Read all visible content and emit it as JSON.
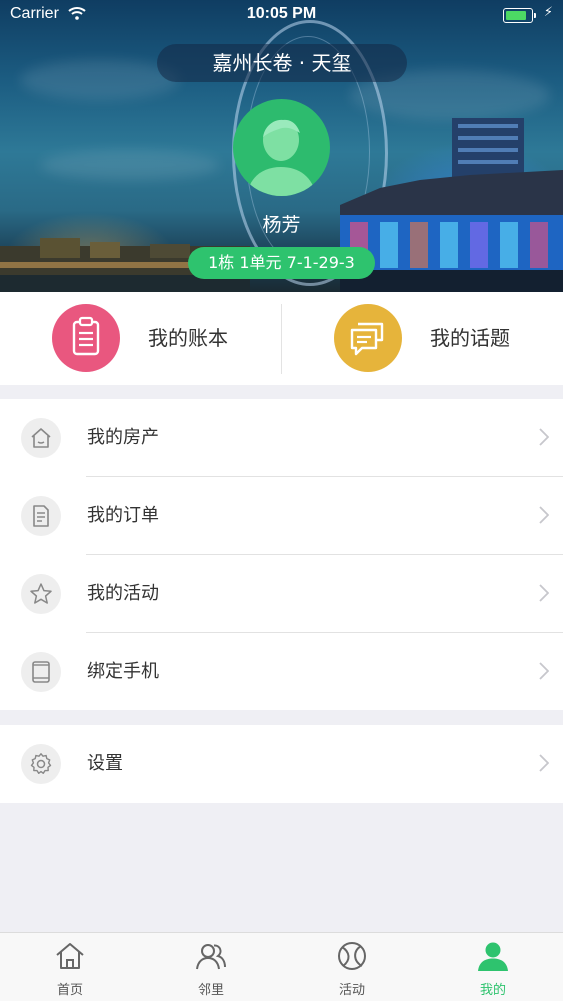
{
  "status_bar": {
    "carrier": "Carrier",
    "time": "10:05 PM"
  },
  "header": {
    "community": "嘉州长卷 · 天玺",
    "user_name": "杨芳",
    "address": "1栋 1单元 7-1-29-3"
  },
  "quick_actions": [
    {
      "label": "我的账本",
      "icon": "clipboard-icon",
      "color": "#e9577f"
    },
    {
      "label": "我的话题",
      "icon": "chat-bubbles-icon",
      "color": "#e6b43b"
    }
  ],
  "menu_group1": [
    {
      "label": "我的房产",
      "icon": "house-icon"
    },
    {
      "label": "我的订单",
      "icon": "document-icon"
    },
    {
      "label": "我的活动",
      "icon": "star-icon"
    },
    {
      "label": "绑定手机",
      "icon": "phone-icon"
    }
  ],
  "menu_group2": [
    {
      "label": "设置",
      "icon": "gear-icon"
    }
  ],
  "tabbar": [
    {
      "label": "首页",
      "icon": "home-icon",
      "active": false
    },
    {
      "label": "邻里",
      "icon": "neighbors-icon",
      "active": false
    },
    {
      "label": "活动",
      "icon": "ball-icon",
      "active": false
    },
    {
      "label": "我的",
      "icon": "person-icon",
      "active": true
    }
  ],
  "colors": {
    "accent": "#2ec36e",
    "background": "#efeff4"
  }
}
